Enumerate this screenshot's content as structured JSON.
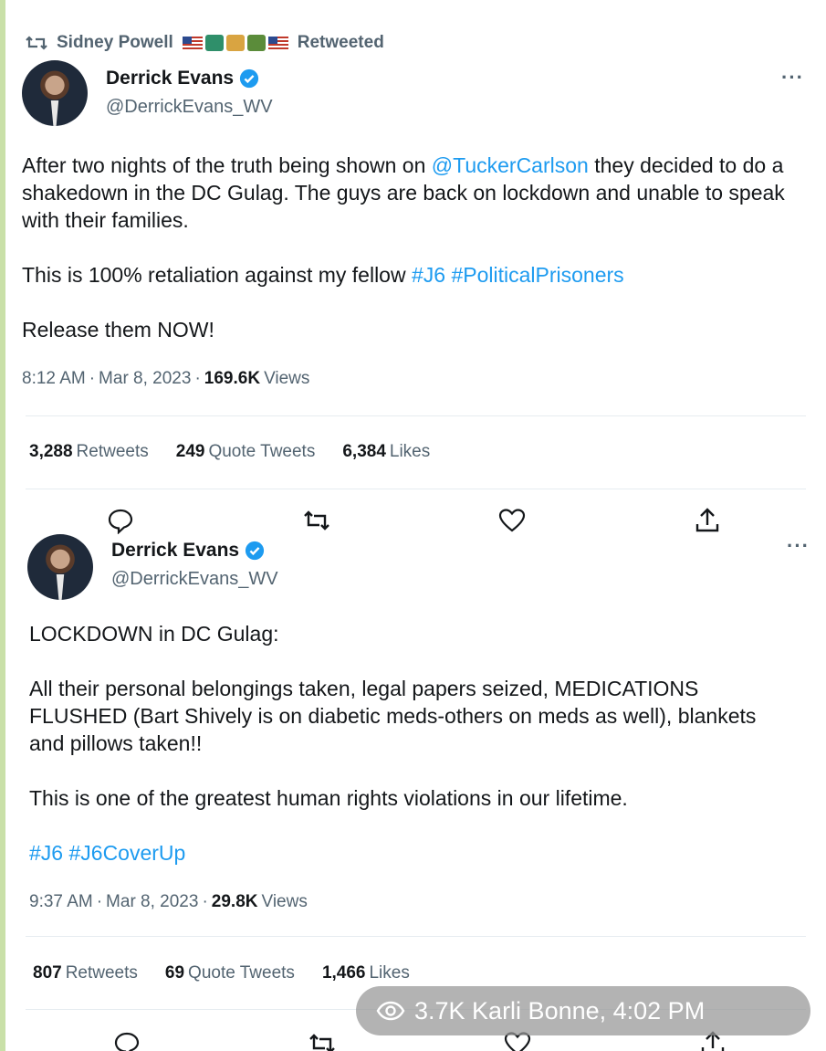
{
  "retweet": {
    "by": "Sidney Powell",
    "label": "Retweeted"
  },
  "tweet1": {
    "author": {
      "name": "Derrick Evans",
      "handle": "@DerrickEvans_WV"
    },
    "text": {
      "p1_a": "After two nights of the truth being shown on ",
      "p1_mention": "@TuckerCarlson",
      "p1_b": " they decided to do a shakedown in the DC Gulag. The guys are back on lockdown and unable to speak with their families.",
      "p2_a": "This is 100% retaliation against my fellow ",
      "p2_tag1": "#J6",
      "p2_tag2": "#PoliticalPrisoners",
      "p3": "Release them NOW!"
    },
    "time": "8:12 AM",
    "date": "Mar 8, 2023",
    "views_count": "169.6K",
    "views_label": "Views",
    "stats": {
      "retweets": "3,288",
      "retweets_label": "Retweets",
      "quotes": "249",
      "quotes_label": "Quote Tweets",
      "likes": "6,384",
      "likes_label": "Likes"
    }
  },
  "tweet2": {
    "author": {
      "name": "Derrick Evans",
      "handle": "@DerrickEvans_WV"
    },
    "text": {
      "p1": "LOCKDOWN in DC Gulag:",
      "p2": "All their personal belongings taken, legal papers seized, MEDICATIONS FLUSHED (Bart Shively is on diabetic meds-others on meds as well), blankets and pillows taken!!",
      "p3": "This is one of the greatest human rights violations in our lifetime.",
      "tag1": "#J6",
      "tag2": "#J6CoverUp"
    },
    "time": "9:37 AM",
    "date": "Mar 8, 2023",
    "views_count": "29.8K",
    "views_label": "Views",
    "stats": {
      "retweets": "807",
      "retweets_label": "Retweets",
      "quotes": "69",
      "quotes_label": "Quote Tweets",
      "likes": "1,466",
      "likes_label": "Likes"
    }
  },
  "toast": {
    "text": "3.7K Karli Bonne, 4:02 PM"
  },
  "icons": {
    "retweet": "retweet-icon",
    "verified": "verified-badge-icon",
    "more": "more-icon",
    "reply": "reply-icon",
    "like": "heart-icon",
    "share": "share-icon",
    "views": "eye-icon"
  },
  "colors": {
    "link": "#1d9bf0",
    "secondary_text": "#536471",
    "verified": "#1d9bf0"
  }
}
